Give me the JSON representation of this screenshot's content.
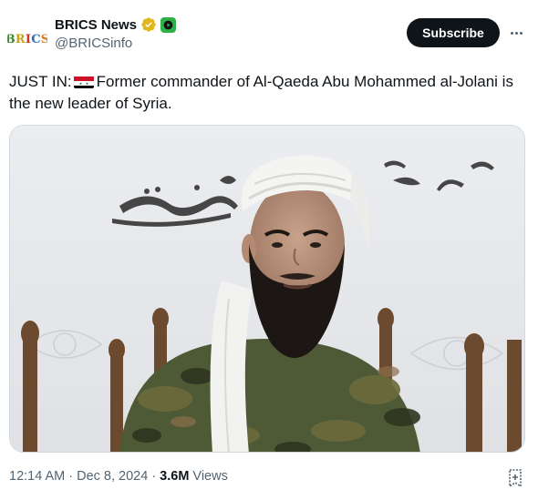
{
  "account": {
    "display_name": "BRICS News",
    "handle": "@BRICSinfo",
    "avatar_text": [
      "B",
      "R",
      "I",
      "C",
      "S"
    ]
  },
  "actions": {
    "subscribe_label": "Subscribe"
  },
  "tweet": {
    "text_prefix": "JUST IN:",
    "text_body": "Former commander of Al-Qaeda Abu Mohammed al-Jolani is the new leader of Syria.",
    "flag_icon": "syria-flag-icon"
  },
  "meta": {
    "time": "12:14 AM",
    "separator": "·",
    "date": "Dec 8, 2024",
    "views_count": "3.6M",
    "views_label": "Views"
  },
  "colors": {
    "text": "#0f1419",
    "secondary": "#536471",
    "verified_gold": "#e2b719",
    "affiliate_green": "#2fb14a"
  }
}
